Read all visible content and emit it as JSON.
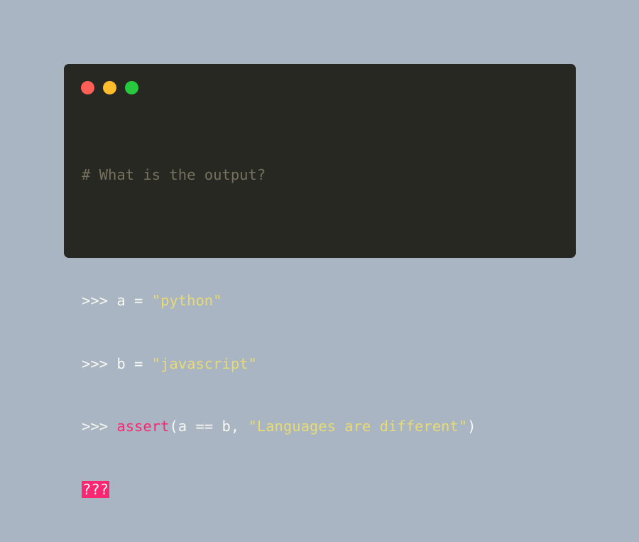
{
  "window": {
    "traffic_lights": [
      {
        "name": "close",
        "color": "#ff5f56"
      },
      {
        "name": "minimize",
        "color": "#ffbd2e"
      },
      {
        "name": "maximize",
        "color": "#27c93f"
      }
    ]
  },
  "code": {
    "comment": "# What is the output?",
    "line1": {
      "prompt": ">>>",
      "code": " a = ",
      "string": "\"python\""
    },
    "line2": {
      "prompt": ">>>",
      "code": " b = ",
      "string": "\"javascript\""
    },
    "line3": {
      "prompt": ">>>",
      "keyword": "assert",
      "code": "(a == b, ",
      "string": "\"Languages are different\"",
      "tail": ")"
    },
    "answer": "???"
  },
  "colors": {
    "background": "#a9b5c2",
    "editor": "#272822",
    "comment": "#75715e",
    "string": "#e6db74",
    "keyword": "#f92672"
  }
}
